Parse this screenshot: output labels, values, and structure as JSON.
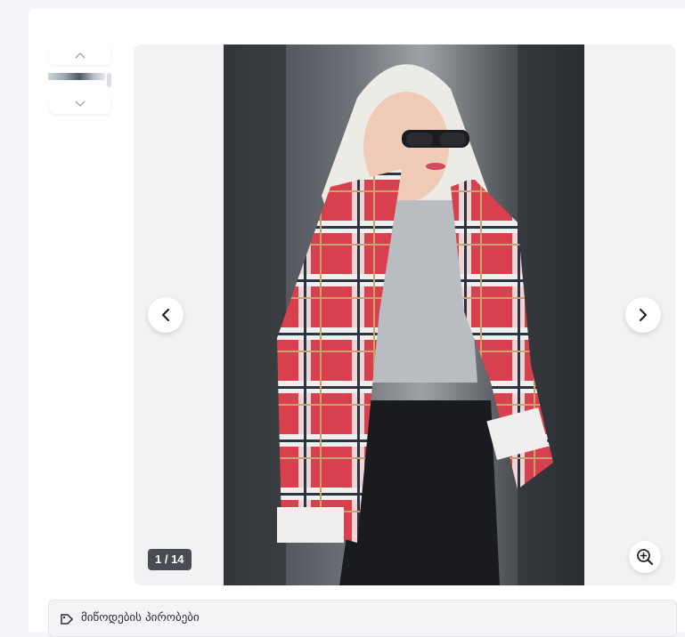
{
  "gallery": {
    "counter_text": "1 / 14",
    "current_index": 1,
    "total": 14,
    "image_alt": "Model wearing red plaid oversized shirt jacket"
  },
  "icons": {
    "thumb_up": "chevron-up-icon",
    "thumb_down": "chevron-down-icon",
    "prev": "chevron-left-icon",
    "next": "chevron-right-icon",
    "zoom": "zoom-in-icon",
    "bottom": "tag-icon"
  },
  "bottom_bar": {
    "text": "მიწოდების პირობები"
  },
  "colors": {
    "background": "#f4f5f8",
    "counter_bg": "#4a4c53"
  }
}
